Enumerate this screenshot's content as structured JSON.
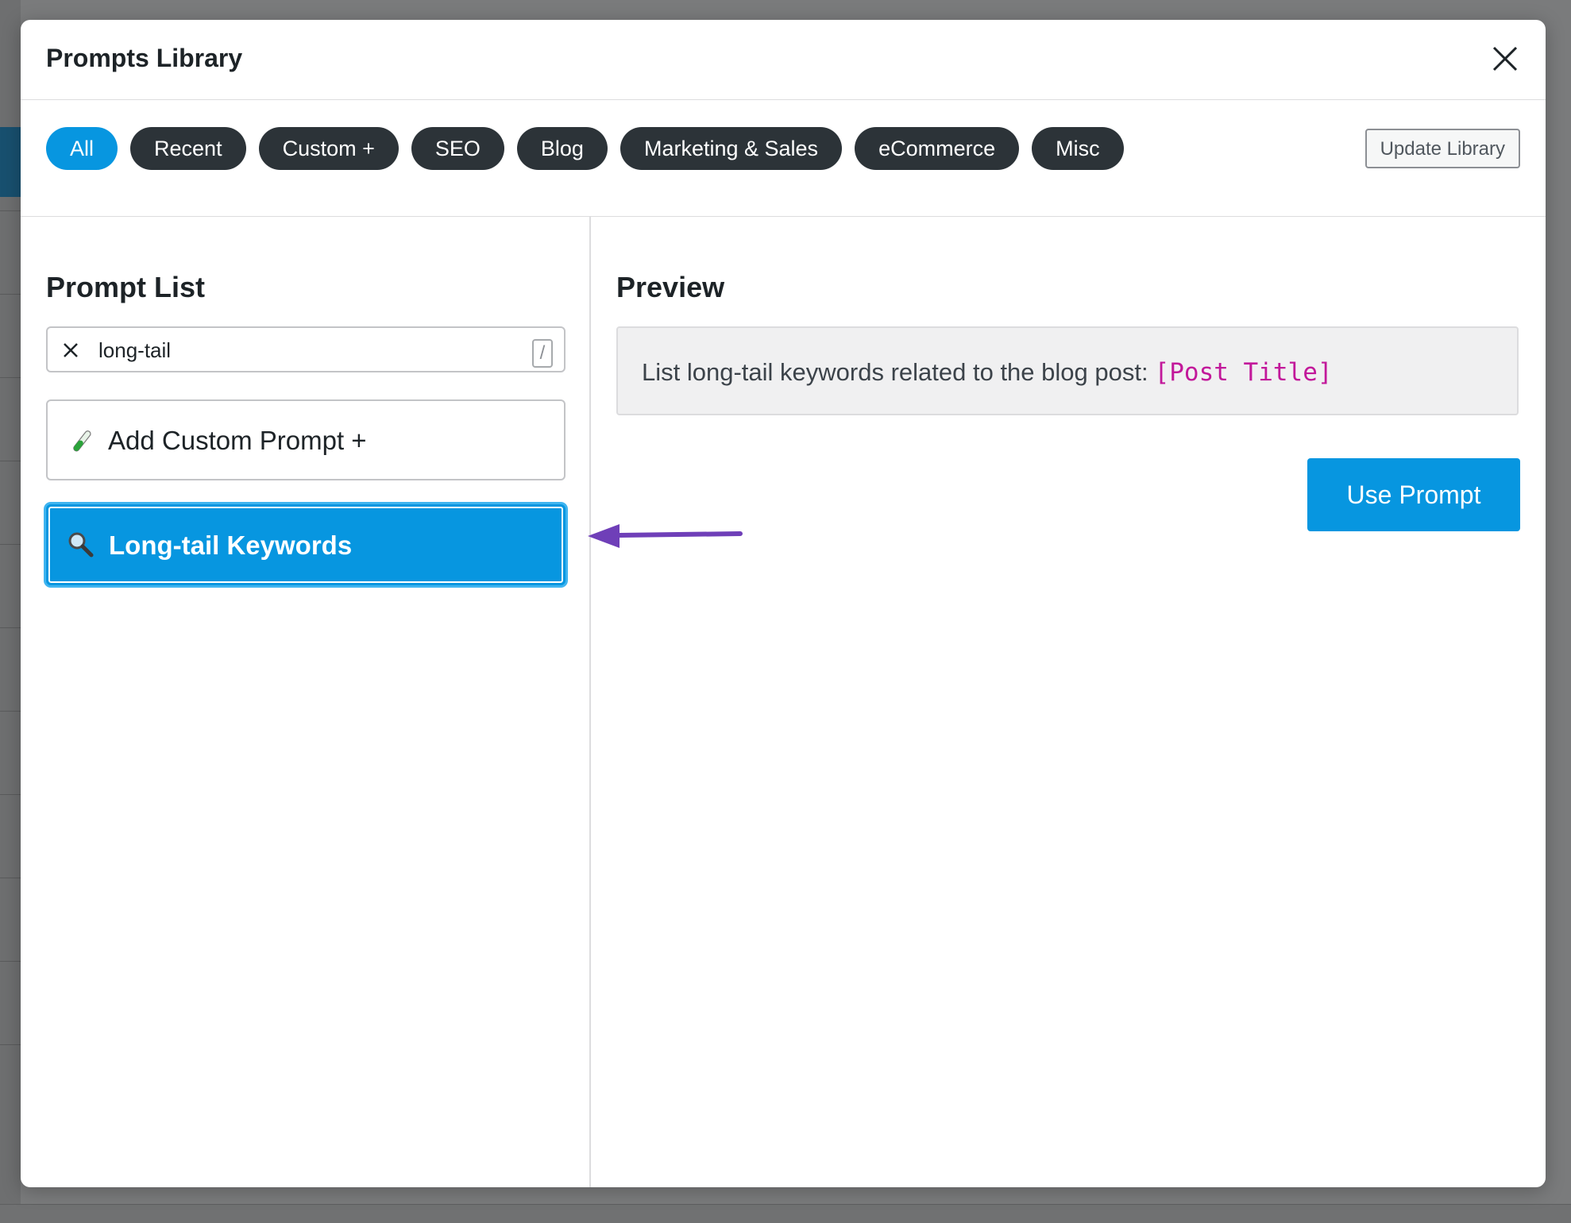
{
  "modal": {
    "title": "Prompts Library"
  },
  "filters": {
    "categories": [
      {
        "label": "All",
        "active": true
      },
      {
        "label": "Recent",
        "active": false
      },
      {
        "label": "Custom +",
        "active": false
      },
      {
        "label": "SEO",
        "active": false
      },
      {
        "label": "Blog",
        "active": false
      },
      {
        "label": "Marketing & Sales",
        "active": false
      },
      {
        "label": "eCommerce",
        "active": false
      },
      {
        "label": "Misc",
        "active": false
      }
    ],
    "update_label": "Update Library"
  },
  "prompt_list": {
    "heading": "Prompt List",
    "search_value": "long-tail",
    "search_shortcut": "/",
    "items": [
      {
        "label": "Add Custom Prompt +",
        "icon": "test-tube-icon",
        "selected": false
      },
      {
        "label": "Long-tail Keywords",
        "icon": "magnifying-glass-icon",
        "selected": true
      }
    ]
  },
  "preview": {
    "heading": "Preview",
    "text": "List long-tail keywords related to the blog post:",
    "variable": "[Post Title]",
    "use_label": "Use Prompt"
  },
  "colors": {
    "accent": "#0796e0",
    "chip_dark": "#2c3338",
    "variable": "#c2189a",
    "arrow": "#6f3fb8"
  }
}
